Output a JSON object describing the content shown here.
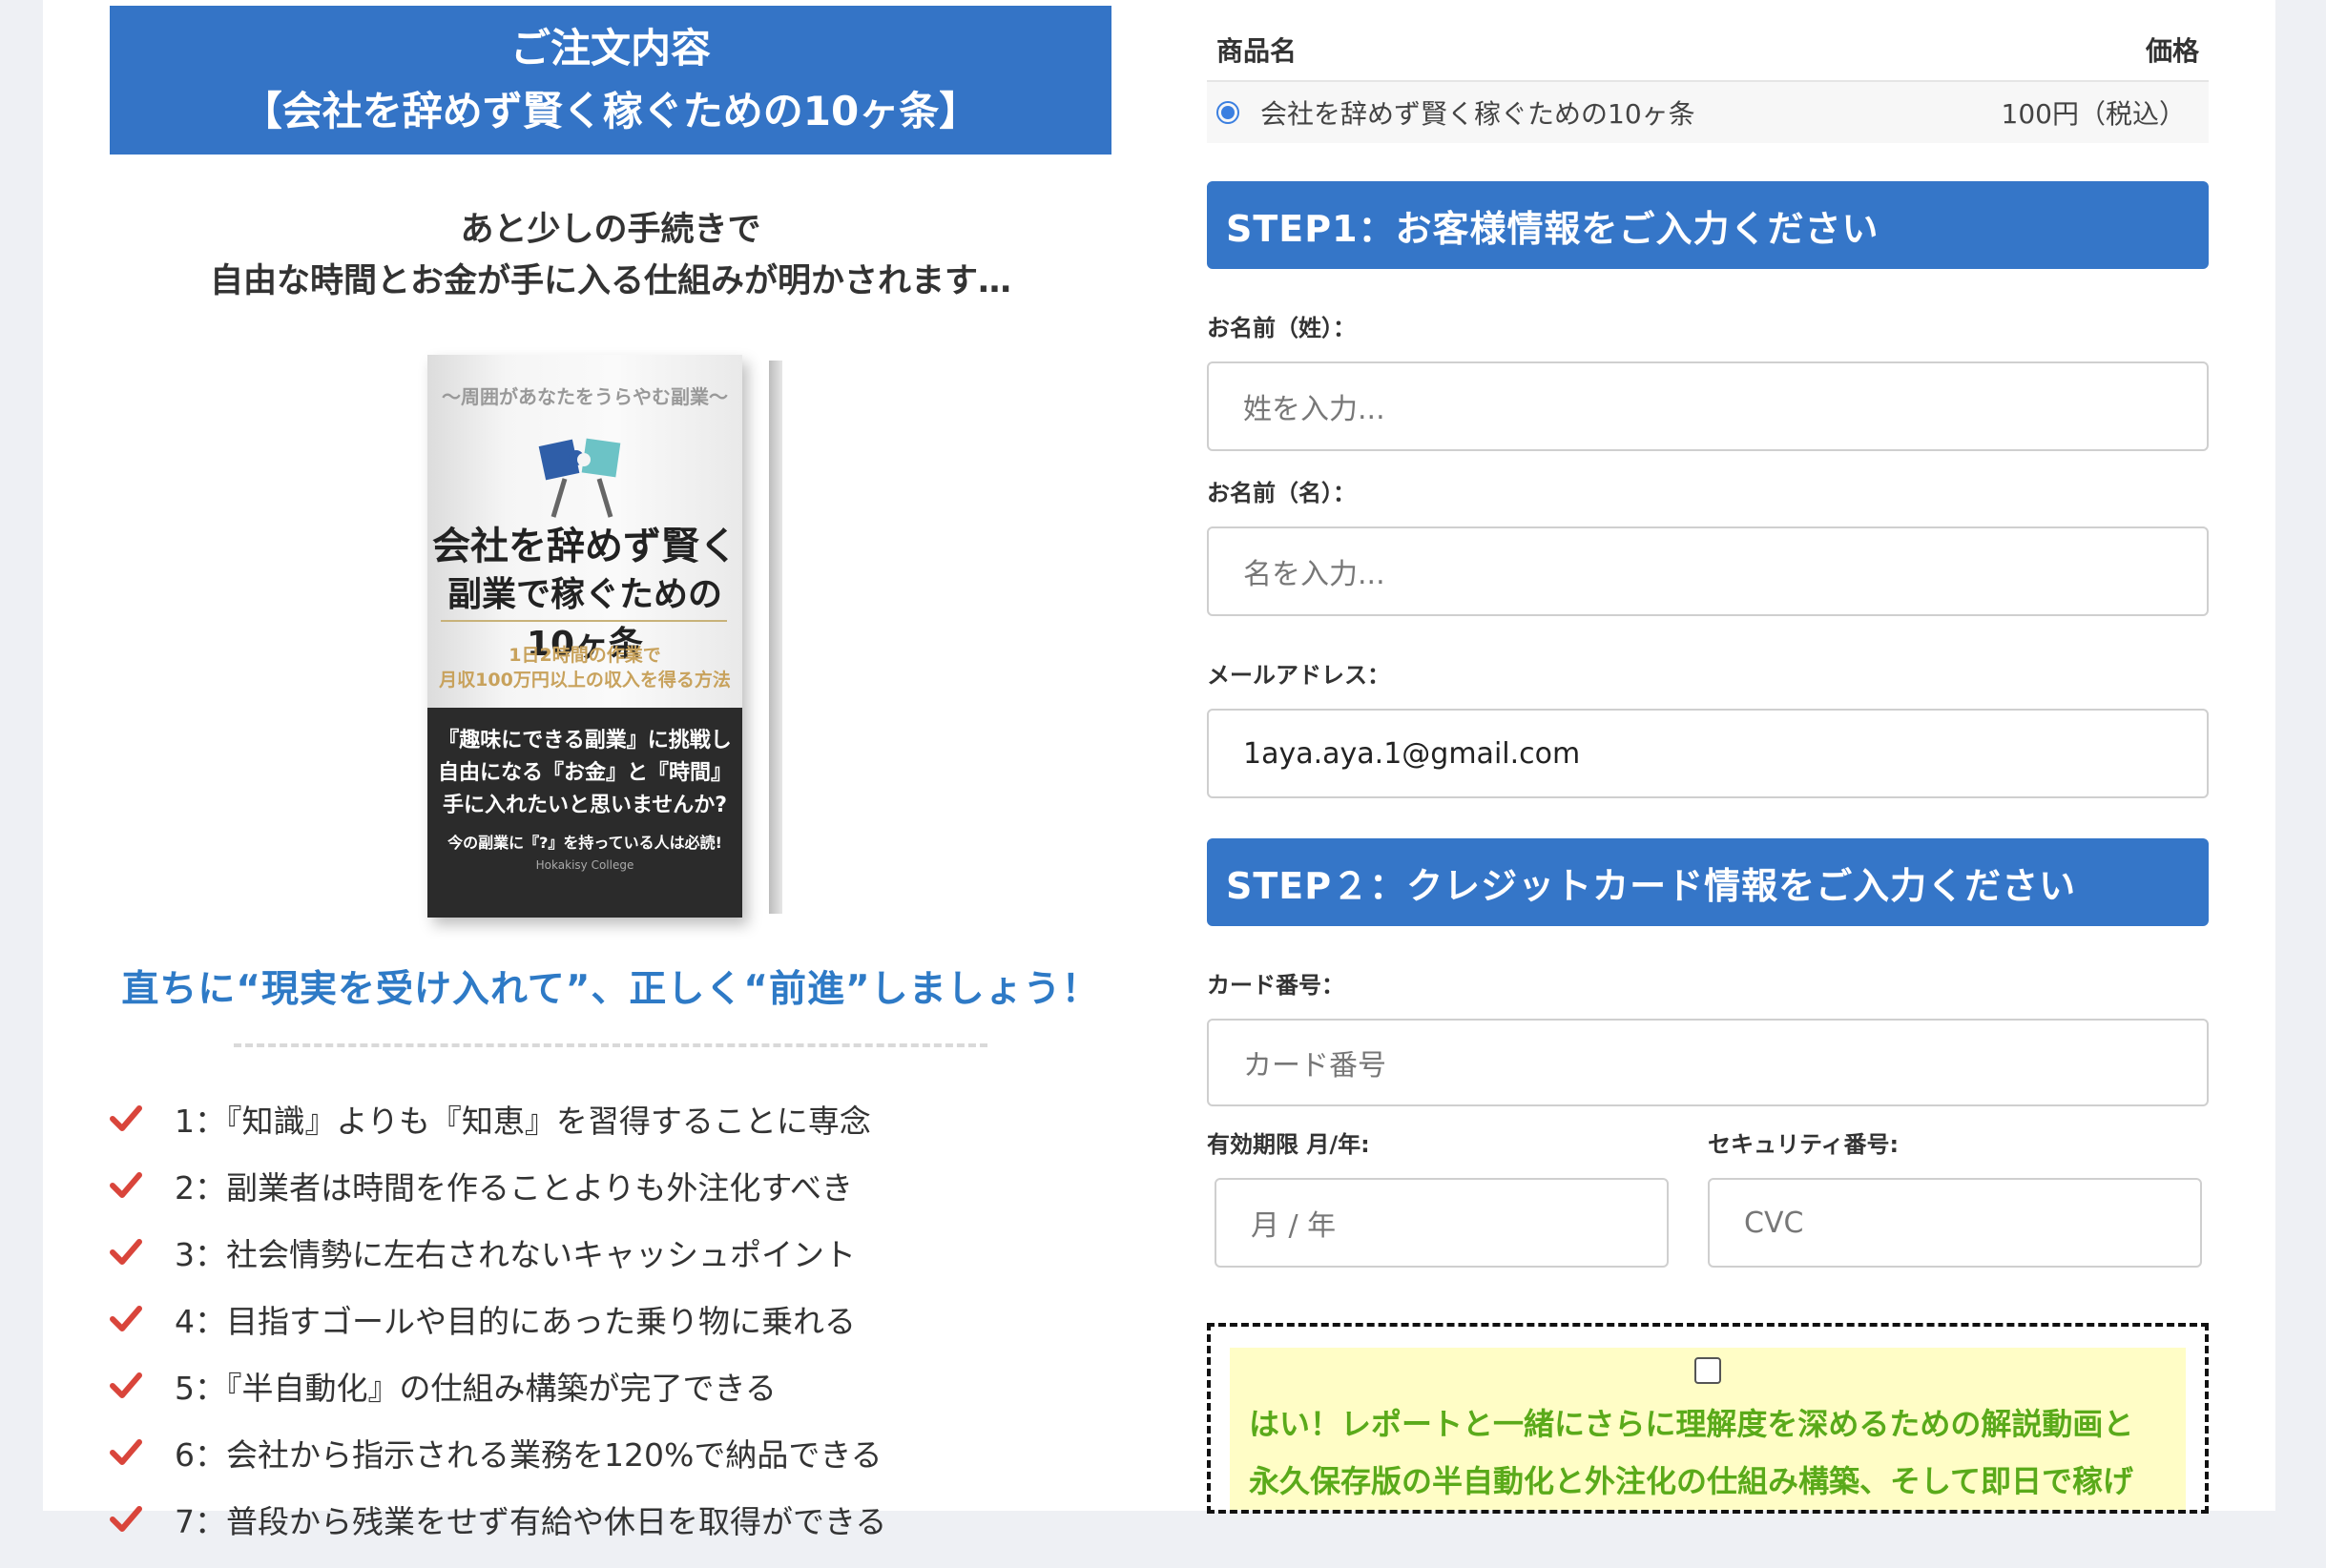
{
  "order": {
    "header_line1": "ご注文内容",
    "header_line2": "【会社を辞めず賢く稼ぐための10ヶ条】",
    "intro_line1": "あと少しの手続きで",
    "intro_line2": "自由な時間とお金が手に入る仕組みが明かされます…"
  },
  "book": {
    "catch": "〜周囲があなたをうらやむ副業〜",
    "title_line1": "会社を辞めず賢く",
    "title_line2": "副業で稼ぐための10ヶ条",
    "sub_line1": "1日2時間の作業で",
    "sub_line2": "月収100万円以上の収入を得る方法",
    "dark_line1": "『趣味にできる副業』に挑戦し",
    "dark_line2": "自由になる『お金』と『時間』",
    "dark_line3": "手に入れたいと思いませんか?",
    "dark_small": "今の副業に『?』を持っている人は必読!",
    "brand": "Hokakisy College"
  },
  "cta": "直ちに“現実を受け入れて”、正しく“前進”しましょう！",
  "points": [
    "1：『知識』よりも『知恵』を習得することに専念",
    "2：副業者は時間を作ることよりも外注化すべき",
    "3：社会情勢に左右されないキャッシュポイント",
    "4：目指すゴールや目的にあった乗り物に乗れる",
    "5：『半自動化』の仕組み構築が完了できる",
    "6：会社から指示される業務を120%で納品できる",
    "7：普段から残業をせず有給や休日を取得ができる"
  ],
  "product": {
    "col_name": "商品名",
    "col_price": "価格",
    "name": "会社を辞めず賢く稼ぐための10ヶ条",
    "price": "100円（税込）"
  },
  "step1": {
    "title": "STEP1：お客様情報をご入力ください",
    "last_name_label": "お名前（姓）：",
    "last_name_placeholder": "姓を入力...",
    "first_name_label": "お名前（名）：",
    "first_name_placeholder": "名を入力...",
    "email_label": "メールアドレス：",
    "email_value": "1aya.aya.1@gmail.com"
  },
  "step2": {
    "title": "STEP２：クレジットカード情報をご入力ください",
    "card_label": "カード番号：",
    "card_placeholder": "カード番号",
    "expiry_label": "有効期限 月/年:",
    "expiry_placeholder": "月 / 年",
    "cvc_label": "セキュリティ番号:",
    "cvc_placeholder": "CVC"
  },
  "option": {
    "text_line1": "はい！レポートと一緒にさらに理解度を深めるための解説動画と",
    "text_line2": "永久保存版の半自動化と外注化の仕組み構築、そして即日で稼げ"
  },
  "colors": {
    "header_blue": "#3474c6",
    "cta_blue": "#2e7ac6",
    "check_red": "#d9453b",
    "option_green": "#5aaa1a",
    "option_bg": "#fffdc6"
  }
}
